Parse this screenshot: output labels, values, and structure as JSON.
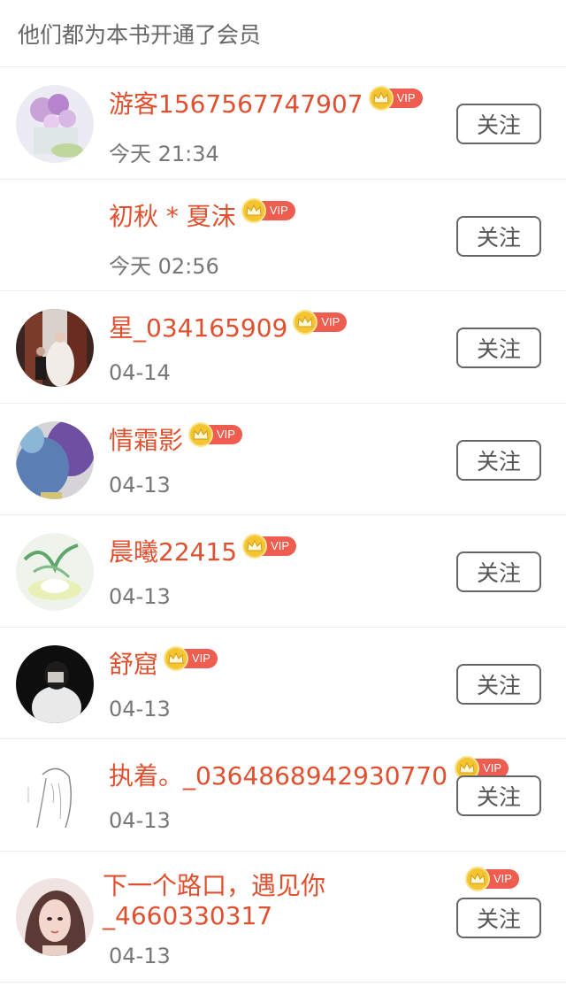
{
  "header": {
    "title": "他们都为本书开通了会员"
  },
  "vip_label": "VIP",
  "follow_label": "关注",
  "colors": {
    "name": "#e0502f",
    "vip_badge": "#ee5d4f",
    "vip_coin": "#f4c431"
  },
  "members": [
    {
      "name": "游客1567567747907",
      "time": "今天 21:34"
    },
    {
      "name": "初秋 * 夏沫",
      "time": "今天 02:56"
    },
    {
      "name": "星_034165909",
      "time": "04-14"
    },
    {
      "name": "情霜影",
      "time": "04-13"
    },
    {
      "name": "晨曦22415",
      "time": "04-13"
    },
    {
      "name": "舒窟",
      "time": "04-13"
    },
    {
      "name": "执着。_0364868942930770",
      "time": "04-13"
    },
    {
      "name": "下一个路口，遇见你_4660330317",
      "time": "04-13"
    }
  ]
}
